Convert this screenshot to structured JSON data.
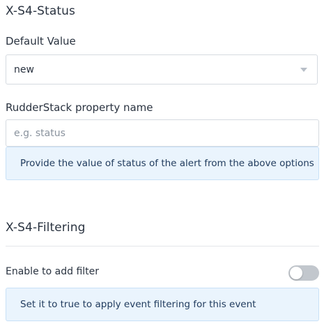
{
  "status_section": {
    "title": "X-S4-Status",
    "default_value_label": "Default Value",
    "default_value_selected": "new",
    "property_name_label": "RudderStack property name",
    "property_name_placeholder": "e.g. status",
    "property_name_value": "",
    "hint": "Provide the value of status of the alert from the above options"
  },
  "filtering_section": {
    "title": "X-S4-Filtering",
    "toggle_label": "Enable to add filter",
    "toggle_on": false,
    "hint": "Set it to true to apply event filtering for this event"
  },
  "colors": {
    "hint_background": "#eaf4fd",
    "hint_border": "#c8e1f7",
    "toggle_off": "#c2c7cd"
  },
  "icons": {
    "select_caret": "chevron-down-icon"
  }
}
